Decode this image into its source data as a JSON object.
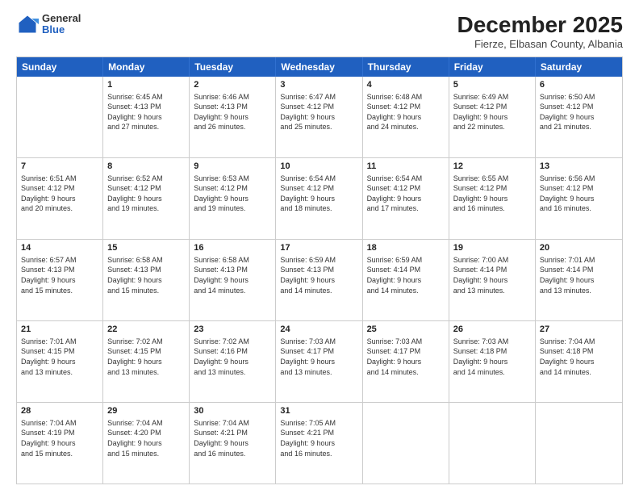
{
  "logo": {
    "general": "General",
    "blue": "Blue"
  },
  "title": "December 2025",
  "subtitle": "Fierze, Elbasan County, Albania",
  "days": [
    "Sunday",
    "Monday",
    "Tuesday",
    "Wednesday",
    "Thursday",
    "Friday",
    "Saturday"
  ],
  "rows": [
    [
      {
        "day": "",
        "info": ""
      },
      {
        "day": "1",
        "info": "Sunrise: 6:45 AM\nSunset: 4:13 PM\nDaylight: 9 hours\nand 27 minutes."
      },
      {
        "day": "2",
        "info": "Sunrise: 6:46 AM\nSunset: 4:13 PM\nDaylight: 9 hours\nand 26 minutes."
      },
      {
        "day": "3",
        "info": "Sunrise: 6:47 AM\nSunset: 4:12 PM\nDaylight: 9 hours\nand 25 minutes."
      },
      {
        "day": "4",
        "info": "Sunrise: 6:48 AM\nSunset: 4:12 PM\nDaylight: 9 hours\nand 24 minutes."
      },
      {
        "day": "5",
        "info": "Sunrise: 6:49 AM\nSunset: 4:12 PM\nDaylight: 9 hours\nand 22 minutes."
      },
      {
        "day": "6",
        "info": "Sunrise: 6:50 AM\nSunset: 4:12 PM\nDaylight: 9 hours\nand 21 minutes."
      }
    ],
    [
      {
        "day": "7",
        "info": "Sunrise: 6:51 AM\nSunset: 4:12 PM\nDaylight: 9 hours\nand 20 minutes."
      },
      {
        "day": "8",
        "info": "Sunrise: 6:52 AM\nSunset: 4:12 PM\nDaylight: 9 hours\nand 19 minutes."
      },
      {
        "day": "9",
        "info": "Sunrise: 6:53 AM\nSunset: 4:12 PM\nDaylight: 9 hours\nand 19 minutes."
      },
      {
        "day": "10",
        "info": "Sunrise: 6:54 AM\nSunset: 4:12 PM\nDaylight: 9 hours\nand 18 minutes."
      },
      {
        "day": "11",
        "info": "Sunrise: 6:54 AM\nSunset: 4:12 PM\nDaylight: 9 hours\nand 17 minutes."
      },
      {
        "day": "12",
        "info": "Sunrise: 6:55 AM\nSunset: 4:12 PM\nDaylight: 9 hours\nand 16 minutes."
      },
      {
        "day": "13",
        "info": "Sunrise: 6:56 AM\nSunset: 4:12 PM\nDaylight: 9 hours\nand 16 minutes."
      }
    ],
    [
      {
        "day": "14",
        "info": "Sunrise: 6:57 AM\nSunset: 4:13 PM\nDaylight: 9 hours\nand 15 minutes."
      },
      {
        "day": "15",
        "info": "Sunrise: 6:58 AM\nSunset: 4:13 PM\nDaylight: 9 hours\nand 15 minutes."
      },
      {
        "day": "16",
        "info": "Sunrise: 6:58 AM\nSunset: 4:13 PM\nDaylight: 9 hours\nand 14 minutes."
      },
      {
        "day": "17",
        "info": "Sunrise: 6:59 AM\nSunset: 4:13 PM\nDaylight: 9 hours\nand 14 minutes."
      },
      {
        "day": "18",
        "info": "Sunrise: 6:59 AM\nSunset: 4:14 PM\nDaylight: 9 hours\nand 14 minutes."
      },
      {
        "day": "19",
        "info": "Sunrise: 7:00 AM\nSunset: 4:14 PM\nDaylight: 9 hours\nand 13 minutes."
      },
      {
        "day": "20",
        "info": "Sunrise: 7:01 AM\nSunset: 4:14 PM\nDaylight: 9 hours\nand 13 minutes."
      }
    ],
    [
      {
        "day": "21",
        "info": "Sunrise: 7:01 AM\nSunset: 4:15 PM\nDaylight: 9 hours\nand 13 minutes."
      },
      {
        "day": "22",
        "info": "Sunrise: 7:02 AM\nSunset: 4:15 PM\nDaylight: 9 hours\nand 13 minutes."
      },
      {
        "day": "23",
        "info": "Sunrise: 7:02 AM\nSunset: 4:16 PM\nDaylight: 9 hours\nand 13 minutes."
      },
      {
        "day": "24",
        "info": "Sunrise: 7:03 AM\nSunset: 4:17 PM\nDaylight: 9 hours\nand 13 minutes."
      },
      {
        "day": "25",
        "info": "Sunrise: 7:03 AM\nSunset: 4:17 PM\nDaylight: 9 hours\nand 14 minutes."
      },
      {
        "day": "26",
        "info": "Sunrise: 7:03 AM\nSunset: 4:18 PM\nDaylight: 9 hours\nand 14 minutes."
      },
      {
        "day": "27",
        "info": "Sunrise: 7:04 AM\nSunset: 4:18 PM\nDaylight: 9 hours\nand 14 minutes."
      }
    ],
    [
      {
        "day": "28",
        "info": "Sunrise: 7:04 AM\nSunset: 4:19 PM\nDaylight: 9 hours\nand 15 minutes."
      },
      {
        "day": "29",
        "info": "Sunrise: 7:04 AM\nSunset: 4:20 PM\nDaylight: 9 hours\nand 15 minutes."
      },
      {
        "day": "30",
        "info": "Sunrise: 7:04 AM\nSunset: 4:21 PM\nDaylight: 9 hours\nand 16 minutes."
      },
      {
        "day": "31",
        "info": "Sunrise: 7:05 AM\nSunset: 4:21 PM\nDaylight: 9 hours\nand 16 minutes."
      },
      {
        "day": "",
        "info": ""
      },
      {
        "day": "",
        "info": ""
      },
      {
        "day": "",
        "info": ""
      }
    ]
  ]
}
